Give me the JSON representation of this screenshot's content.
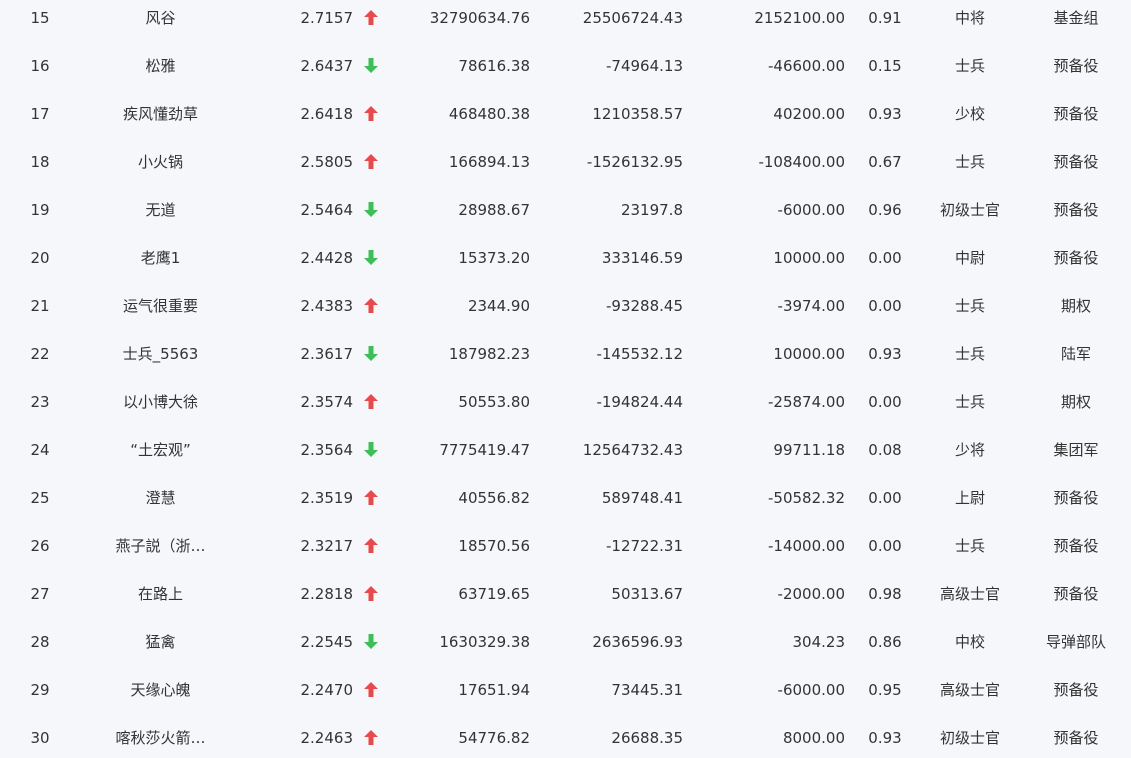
{
  "colors": {
    "up": "#e84a4a",
    "down": "#3cbf56",
    "text": "#333333",
    "background": "#f5f7fb"
  },
  "icons": {
    "up": "arrow-up-icon",
    "down": "arrow-down-icon"
  },
  "rows": [
    {
      "rank": "15",
      "name": "风谷",
      "score": "2.7157",
      "trend": "up",
      "v1": "32790634.76",
      "v2": "25506724.43",
      "v3": "2152100.00",
      "ratio": "0.91",
      "rank_title": "中将",
      "unit": "基金组"
    },
    {
      "rank": "16",
      "name": "松雅",
      "score": "2.6437",
      "trend": "down",
      "v1": "78616.38",
      "v2": "-74964.13",
      "v3": "-46600.00",
      "ratio": "0.15",
      "rank_title": "士兵",
      "unit": "预备役"
    },
    {
      "rank": "17",
      "name": "疾风懂劲草",
      "score": "2.6418",
      "trend": "up",
      "v1": "468480.38",
      "v2": "1210358.57",
      "v3": "40200.00",
      "ratio": "0.93",
      "rank_title": "少校",
      "unit": "预备役"
    },
    {
      "rank": "18",
      "name": "小火锅",
      "score": "2.5805",
      "trend": "up",
      "v1": "166894.13",
      "v2": "-1526132.95",
      "v3": "-108400.00",
      "ratio": "0.67",
      "rank_title": "士兵",
      "unit": "预备役"
    },
    {
      "rank": "19",
      "name": "无道",
      "score": "2.5464",
      "trend": "down",
      "v1": "28988.67",
      "v2": "23197.8",
      "v3": "-6000.00",
      "ratio": "0.96",
      "rank_title": "初级士官",
      "unit": "预备役"
    },
    {
      "rank": "20",
      "name": "老鹰1",
      "score": "2.4428",
      "trend": "down",
      "v1": "15373.20",
      "v2": "333146.59",
      "v3": "10000.00",
      "ratio": "0.00",
      "rank_title": "中尉",
      "unit": "预备役"
    },
    {
      "rank": "21",
      "name": "运气很重要",
      "score": "2.4383",
      "trend": "up",
      "v1": "2344.90",
      "v2": "-93288.45",
      "v3": "-3974.00",
      "ratio": "0.00",
      "rank_title": "士兵",
      "unit": "期权"
    },
    {
      "rank": "22",
      "name": "士兵_5563",
      "score": "2.3617",
      "trend": "down",
      "v1": "187982.23",
      "v2": "-145532.12",
      "v3": "10000.00",
      "ratio": "0.93",
      "rank_title": "士兵",
      "unit": "陆军"
    },
    {
      "rank": "23",
      "name": "以小博大徐",
      "score": "2.3574",
      "trend": "up",
      "v1": "50553.80",
      "v2": "-194824.44",
      "v3": "-25874.00",
      "ratio": "0.00",
      "rank_title": "士兵",
      "unit": "期权"
    },
    {
      "rank": "24",
      "name": "“土宏观”",
      "score": "2.3564",
      "trend": "down",
      "v1": "7775419.47",
      "v2": "12564732.43",
      "v3": "99711.18",
      "ratio": "0.08",
      "rank_title": "少将",
      "unit": "集团军"
    },
    {
      "rank": "25",
      "name": "澄慧",
      "score": "2.3519",
      "trend": "up",
      "v1": "40556.82",
      "v2": "589748.41",
      "v3": "-50582.32",
      "ratio": "0.00",
      "rank_title": "上尉",
      "unit": "预备役"
    },
    {
      "rank": "26",
      "name": "燕子説（浙…",
      "score": "2.3217",
      "trend": "up",
      "v1": "18570.56",
      "v2": "-12722.31",
      "v3": "-14000.00",
      "ratio": "0.00",
      "rank_title": "士兵",
      "unit": "预备役"
    },
    {
      "rank": "27",
      "name": "在路上",
      "score": "2.2818",
      "trend": "up",
      "v1": "63719.65",
      "v2": "50313.67",
      "v3": "-2000.00",
      "ratio": "0.98",
      "rank_title": "高级士官",
      "unit": "预备役"
    },
    {
      "rank": "28",
      "name": "猛禽",
      "score": "2.2545",
      "trend": "down",
      "v1": "1630329.38",
      "v2": "2636596.93",
      "v3": "304.23",
      "ratio": "0.86",
      "rank_title": "中校",
      "unit": "导弹部队"
    },
    {
      "rank": "29",
      "name": "天缘心魄",
      "score": "2.2470",
      "trend": "up",
      "v1": "17651.94",
      "v2": "73445.31",
      "v3": "-6000.00",
      "ratio": "0.95",
      "rank_title": "高级士官",
      "unit": "预备役"
    },
    {
      "rank": "30",
      "name": "喀秋莎火箭…",
      "score": "2.2463",
      "trend": "up",
      "v1": "54776.82",
      "v2": "26688.35",
      "v3": "8000.00",
      "ratio": "0.93",
      "rank_title": "初级士官",
      "unit": "预备役"
    }
  ]
}
